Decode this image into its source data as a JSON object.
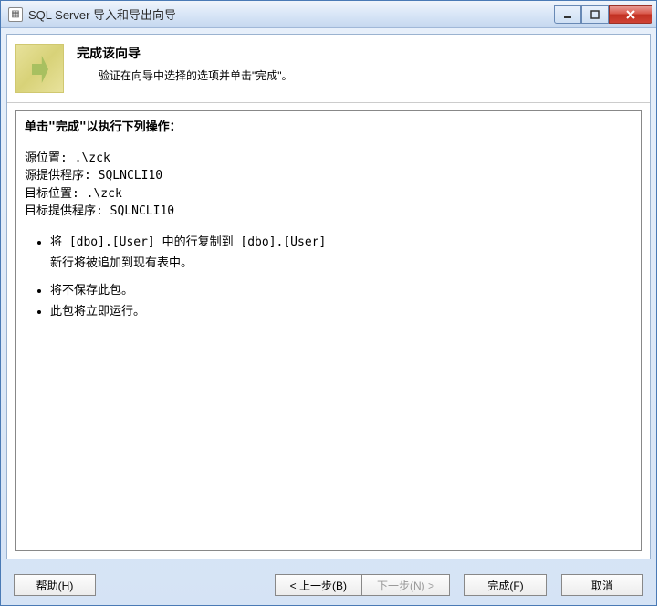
{
  "window": {
    "title": "SQL Server 导入和导出向导"
  },
  "header": {
    "title": "完成该向导",
    "subtitle": "验证在向导中选择的选项并单击\"完成\"。"
  },
  "main": {
    "heading": "单击\"完成\"以执行下列操作：",
    "source_location_label": "源位置:",
    "source_location_value": ".\\zck",
    "source_provider_label": "源提供程序:",
    "source_provider_value": "SQLNCLI10",
    "dest_location_label": "目标位置:",
    "dest_location_value": ".\\zck",
    "dest_provider_label": "目标提供程序:",
    "dest_provider_value": "SQLNCLI10",
    "bullets1": [
      "将 [dbo].[User] 中的行复制到 [dbo].[User]",
      "新行将被追加到现有表中。"
    ],
    "bullets2": [
      "将不保存此包。",
      "此包将立即运行。"
    ]
  },
  "buttons": {
    "help": "帮助(H)",
    "back": "< 上一步(B)",
    "next": "下一步(N) >",
    "finish": "完成(F)",
    "cancel": "取消"
  }
}
